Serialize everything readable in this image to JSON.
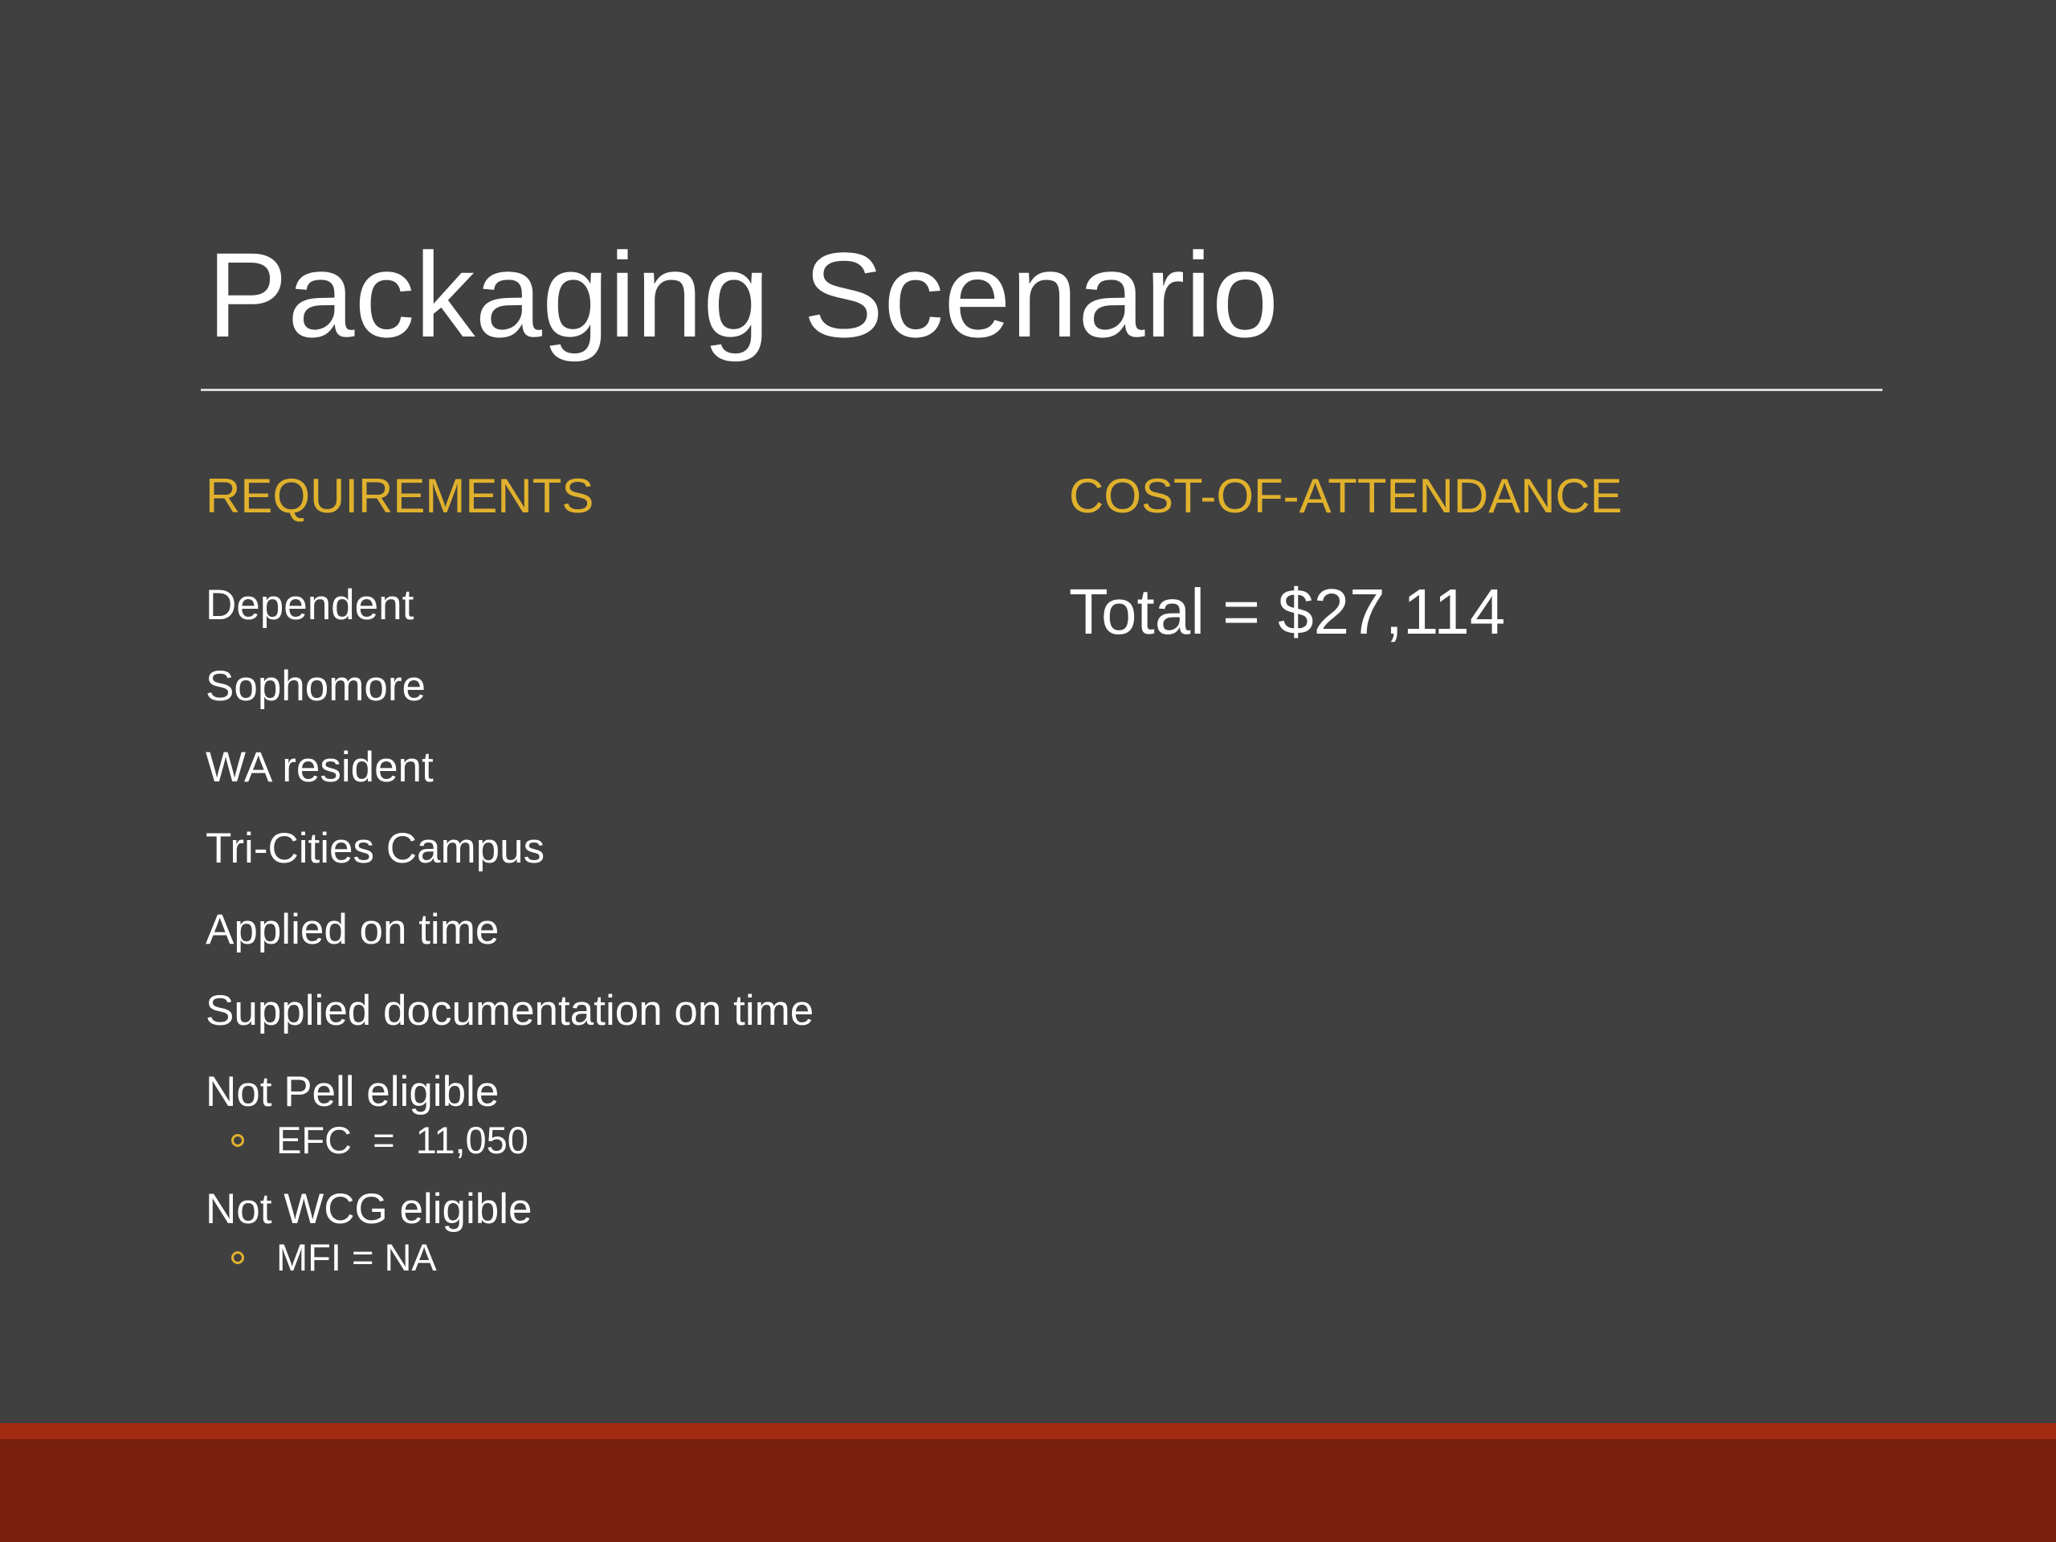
{
  "slide": {
    "title": "Packaging Scenario",
    "requirements": {
      "heading": "REQUIREMENTS",
      "items": [
        {
          "text": "Dependent"
        },
        {
          "text": "Sophomore"
        },
        {
          "text": "WA resident"
        },
        {
          "text": "Tri-Cities Campus"
        },
        {
          "text": "Applied on time"
        },
        {
          "text": "Supplied documentation on time"
        },
        {
          "text": "Not Pell eligible",
          "sub": "EFC  =  11,050"
        },
        {
          "text": "Not WCG eligible",
          "sub": "MFI = NA"
        }
      ]
    },
    "cost_of_attendance": {
      "heading": "COST-OF-ATTENDANCE",
      "total": "Total = $27,114"
    }
  },
  "colors": {
    "background": "#404040",
    "accent": "#e0b12c",
    "footer": "#78200d",
    "footer_stripe": "#a32b12",
    "text": "#ffffff"
  }
}
